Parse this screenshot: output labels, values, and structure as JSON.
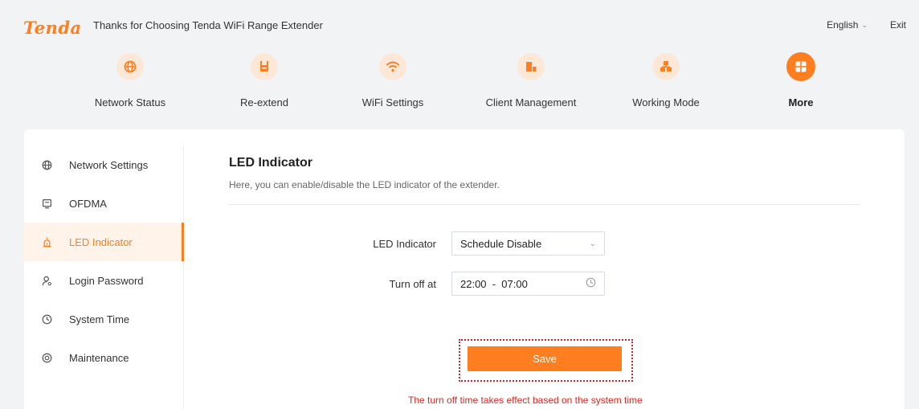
{
  "header": {
    "logo": "Tenda",
    "tagline": "Thanks for Choosing Tenda WiFi Range Extender",
    "language": "English",
    "exit_label": "Exit"
  },
  "nav": {
    "items": [
      {
        "label": "Network Status",
        "icon": "globe-icon"
      },
      {
        "label": "Re-extend",
        "icon": "extender-icon"
      },
      {
        "label": "WiFi Settings",
        "icon": "wifi-icon"
      },
      {
        "label": "Client Management",
        "icon": "devices-icon"
      },
      {
        "label": "Working Mode",
        "icon": "network-mode-icon"
      },
      {
        "label": "More",
        "icon": "grid-icon",
        "active": true
      }
    ]
  },
  "sidebar": {
    "items": [
      {
        "label": "Network Settings",
        "icon": "globe-icon"
      },
      {
        "label": "OFDMA",
        "icon": "ofdma-icon"
      },
      {
        "label": "LED Indicator",
        "icon": "led-icon",
        "active": true
      },
      {
        "label": "Login Password",
        "icon": "user-icon"
      },
      {
        "label": "System Time",
        "icon": "clock-icon"
      },
      {
        "label": "Maintenance",
        "icon": "maintenance-icon"
      }
    ]
  },
  "main": {
    "title": "LED Indicator",
    "description": "Here, you can enable/disable the LED indicator of the extender.",
    "led_label": "LED Indicator",
    "led_value": "Schedule Disable",
    "turnoff_label": "Turn off at",
    "turnoff_value": "22:00  -  07:00",
    "save_label": "Save",
    "hint": "The turn off time takes effect based on the system time"
  },
  "colors": {
    "accent": "#ff7e1f",
    "accent_light": "#fde8d8",
    "error": "#e8251c"
  }
}
